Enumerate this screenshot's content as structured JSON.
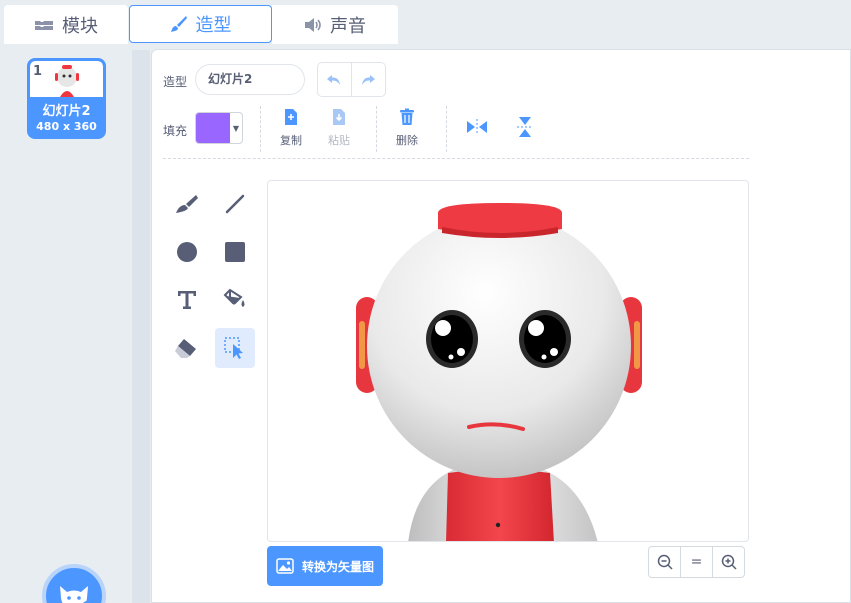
{
  "tabs": [
    {
      "label": "模块",
      "icon": "blocks-icon"
    },
    {
      "label": "造型",
      "icon": "brush-icon",
      "active": true
    },
    {
      "label": "声音",
      "icon": "speaker-icon"
    }
  ],
  "costume_list": {
    "items": [
      {
        "number": "1",
        "name": "幻灯片2",
        "size": "480 x 360",
        "selected": true
      }
    ]
  },
  "editor": {
    "costume_label": "造型",
    "costume_name": "幻灯片2",
    "fill_label": "填充",
    "fill_color": "#9966ff",
    "copy_label": "复制",
    "paste_label": "粘贴",
    "delete_label": "删除",
    "convert_label": "转换为矢量图",
    "zoom_reset": "="
  },
  "colors": {
    "accent": "#4c97ff",
    "text": "#575e75",
    "robot_red": "#f0373f"
  }
}
